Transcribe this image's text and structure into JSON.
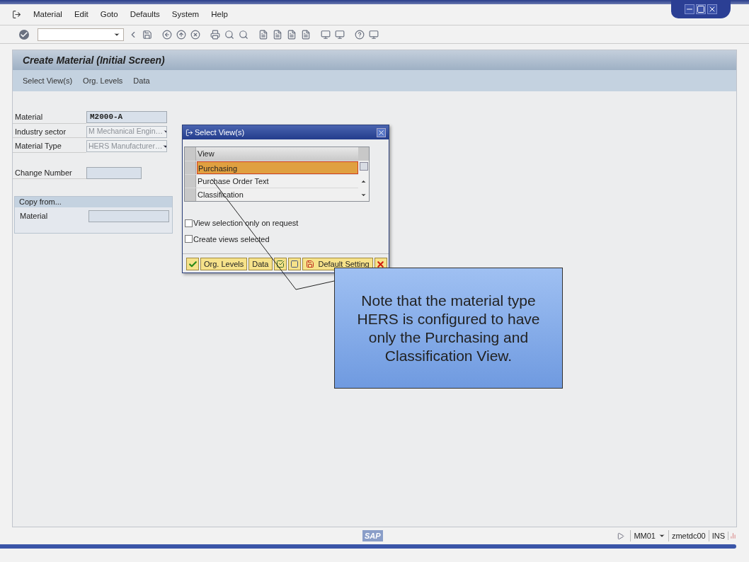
{
  "menu": [
    "Material",
    "Edit",
    "Goto",
    "Defaults",
    "System",
    "Help"
  ],
  "title": "Create Material (Initial Screen)",
  "app_toolbar": [
    "Select View(s)",
    "Org. Levels",
    "Data"
  ],
  "fields": [
    {
      "label": "Material",
      "value": "M2000-A",
      "kind": "text"
    },
    {
      "label": "Industry sector",
      "value": "M Mechanical Engin…",
      "kind": "dropdown"
    },
    {
      "label": "Material Type",
      "value": "HERS Manufacturer…",
      "kind": "dropdown"
    },
    {
      "label": "Change Number",
      "kind": "empty"
    }
  ],
  "copy_from": {
    "title": "Copy from...",
    "fields": [
      {
        "label": "Material"
      }
    ]
  },
  "dialog": {
    "title": "Select View(s)",
    "column": "View",
    "rows": [
      {
        "label": "Purchasing",
        "selected": true
      },
      {
        "label": "Purchase Order Text",
        "selected": false
      },
      {
        "label": "Classification",
        "selected": false
      }
    ],
    "checkboxes": [
      {
        "label": "View selection only on request",
        "checked": false
      },
      {
        "label": "Create views selected",
        "checked": false
      }
    ],
    "buttons": [
      {
        "kind": "ok"
      },
      {
        "kind": "text",
        "label": "Org. Levels"
      },
      {
        "kind": "text",
        "label": "Data"
      },
      {
        "kind": "select-all"
      },
      {
        "kind": "deselect"
      },
      {
        "kind": "save-text",
        "label": "Default Setting"
      },
      {
        "kind": "cancel"
      }
    ]
  },
  "note": "Note that the material type HERS is configured to have only the Purchasing and Classification View.",
  "status_bar": {
    "logo": "SAP",
    "transaction": "MM01",
    "server": "zmetdc00",
    "mode": "INS"
  }
}
